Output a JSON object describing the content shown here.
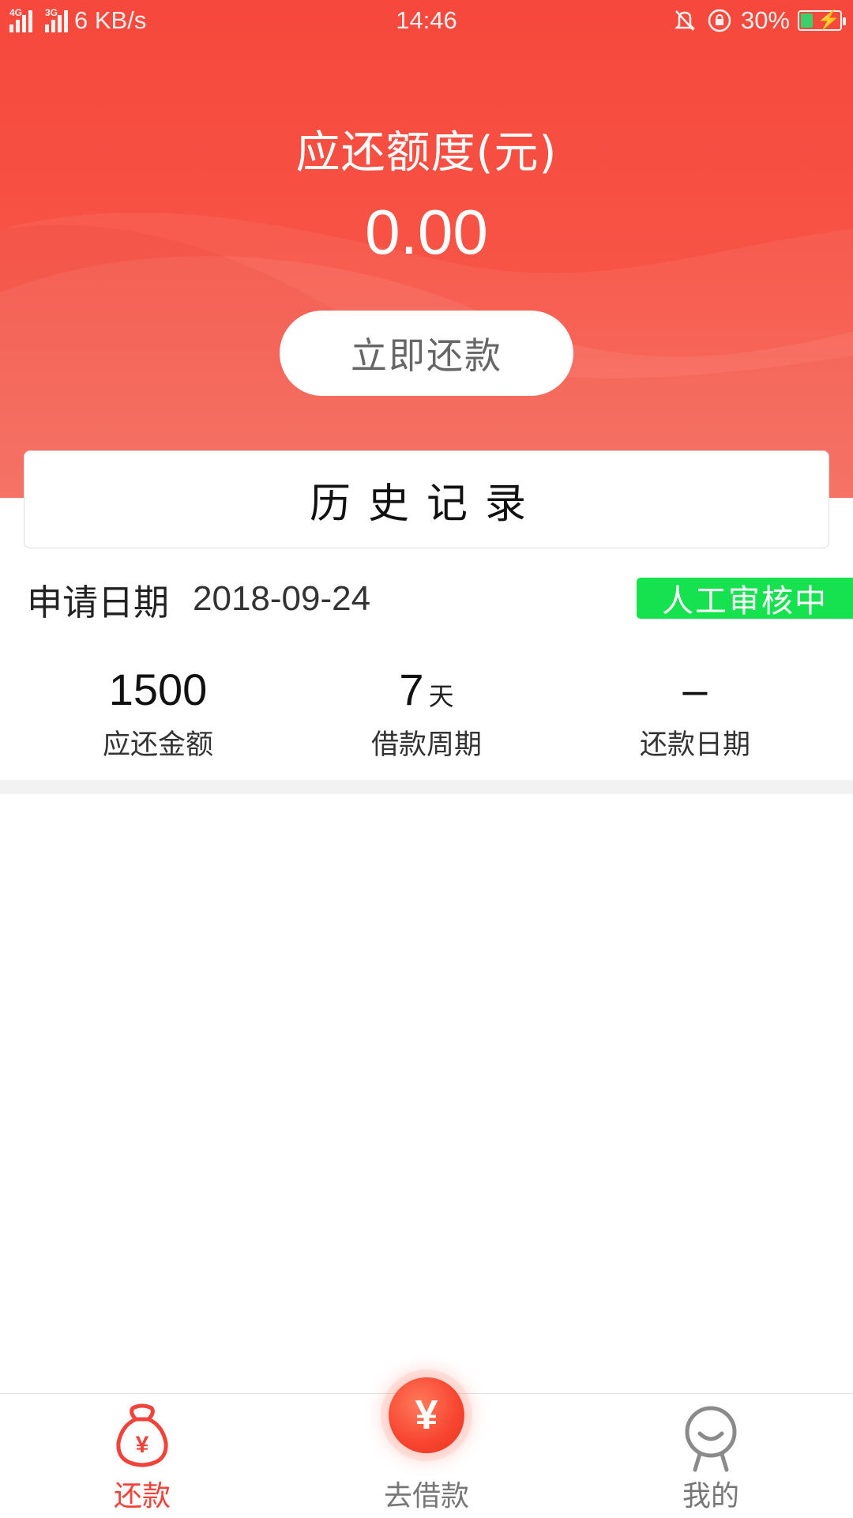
{
  "status_bar": {
    "net_1": "4G",
    "net_2": "3G",
    "speed": "6 KB/s",
    "time": "14:46",
    "battery": "30%",
    "battery_level": 0.3
  },
  "header": {
    "title": "应还额度(元)",
    "amount": "0.00",
    "repay_button": "立即还款"
  },
  "history": {
    "label": "历史记录"
  },
  "record": {
    "date_label": "申请日期",
    "date_value": "2018-09-24",
    "status": "人工审核中",
    "stats": [
      {
        "value": "1500",
        "unit": "",
        "label": "应还金额"
      },
      {
        "value": "7",
        "unit": "天",
        "label": "借款周期"
      },
      {
        "value": "–",
        "unit": "",
        "label": "还款日期"
      }
    ]
  },
  "bottom_nav": {
    "items": [
      {
        "label": "还款",
        "icon": "money-bag-icon",
        "active": true
      },
      {
        "label": "去借款",
        "icon": "yuan-icon",
        "active": false
      },
      {
        "label": "我的",
        "icon": "user-icon",
        "active": false
      }
    ],
    "fab_symbol": "¥"
  },
  "colors": {
    "primary_red": "#f6483c",
    "badge_green": "#16e24f",
    "nav_active": "#f0433a",
    "nav_inactive": "#777777"
  }
}
